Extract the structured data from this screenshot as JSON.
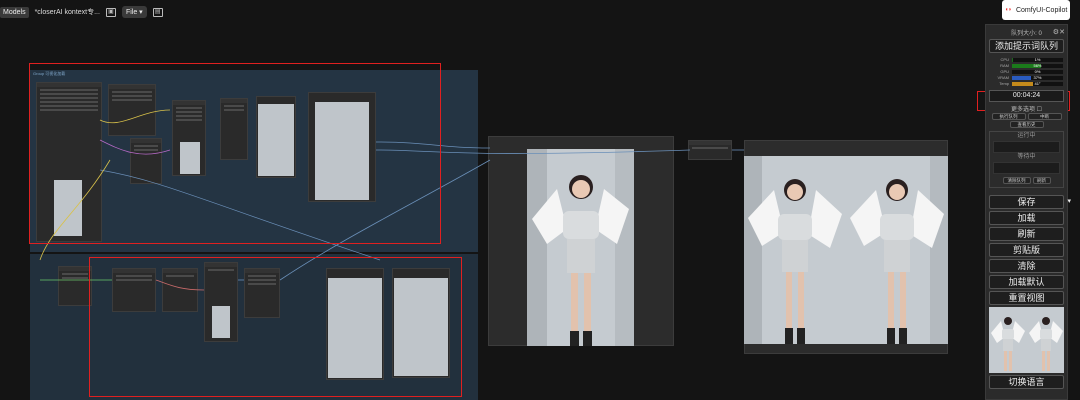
{
  "topbar": {
    "models_label": "Models",
    "workflow_title": "*closerAI kontext专...",
    "image_icon": "image-icon",
    "file_label": "File",
    "file_caret": "▾",
    "save_icon": "save-icon"
  },
  "copilot": {
    "label": "ComfyUI-Copilot",
    "icon": "copilot-logo-icon"
  },
  "canvas": {
    "group_title": "Group 可视化加载"
  },
  "panel": {
    "queue_size_label": "队列大小: 0",
    "add_prompt_queue": "添加提示词队列",
    "stats": [
      {
        "label": "CPU",
        "value": "1%",
        "fraction": 0.01,
        "color": "#1b6b1b"
      },
      {
        "label": "RAM",
        "value": "56%",
        "fraction": 0.56,
        "color": "#1b7a1b"
      },
      {
        "label": "GPU",
        "value": "0%",
        "fraction": 0.0,
        "color": "#1b6b1b"
      },
      {
        "label": "VRAM",
        "value": "37%",
        "fraction": 0.37,
        "color": "#2a5bbf"
      },
      {
        "label": "Temp",
        "value": "41°",
        "fraction": 0.41,
        "color": "#c48a1b"
      }
    ],
    "timer": "00:04:24",
    "more_options": "更多选项 ☐",
    "small_btns": [
      "执行队列",
      "中断",
      "查看历史"
    ],
    "running_label": "运行中",
    "pending_label": "等待中",
    "queue_btns": [
      "清除队列",
      "刷新"
    ],
    "save_label": "保存",
    "save_caret": "▾",
    "load_label": "加载",
    "refresh_label": "刷新",
    "clipspace_label": "剪贴版",
    "clear_label": "清除",
    "load_default_label": "加载默认",
    "reset_view_label": "重置视图",
    "switch_lang_label": "切换语言"
  }
}
